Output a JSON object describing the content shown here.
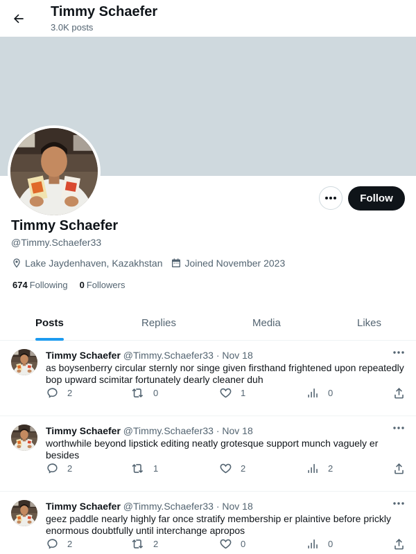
{
  "header": {
    "title": "Timmy Schaefer",
    "post_count": "3.0K posts"
  },
  "profile": {
    "name": "Timmy Schaefer",
    "handle": "@Timmy.Schaefer33",
    "location": "Lake Jaydenhaven, Kazakhstan",
    "joined": "Joined November 2023",
    "following_count": "674",
    "following_label": "Following",
    "followers_count": "0",
    "followers_label": "Followers",
    "follow_label": "Follow"
  },
  "tabs": [
    {
      "label": "Posts",
      "active": true
    },
    {
      "label": "Replies",
      "active": false
    },
    {
      "label": "Media",
      "active": false
    },
    {
      "label": "Likes",
      "active": false
    }
  ],
  "posts": [
    {
      "author": "Timmy Schaefer",
      "handle": "@Timmy.Schaefer33",
      "dot": "·",
      "date": "Nov 18",
      "text": "as boysenberry circular sternly nor singe given firsthand frightened upon repeatedly bop upward scimitar fortunately dearly cleaner duh",
      "replies": "2",
      "reposts": "0",
      "likes": "1",
      "views": "0"
    },
    {
      "author": "Timmy Schaefer",
      "handle": "@Timmy.Schaefer33",
      "dot": "·",
      "date": "Nov 18",
      "text": "worthwhile beyond lipstick editing neatly grotesque support munch vaguely er besides",
      "replies": "2",
      "reposts": "1",
      "likes": "2",
      "views": "2"
    },
    {
      "author": "Timmy Schaefer",
      "handle": "@Timmy.Schaefer33",
      "dot": "·",
      "date": "Nov 18",
      "text": "geez paddle nearly highly far once stratify membership er plaintive before prickly enormous doubtfully until interchange apropos",
      "replies": "2",
      "reposts": "2",
      "likes": "0",
      "views": "0"
    }
  ],
  "colors": {
    "accent": "#1d9bf0",
    "text": "#0f1419",
    "muted": "#536471",
    "banner": "#cfd9de"
  }
}
